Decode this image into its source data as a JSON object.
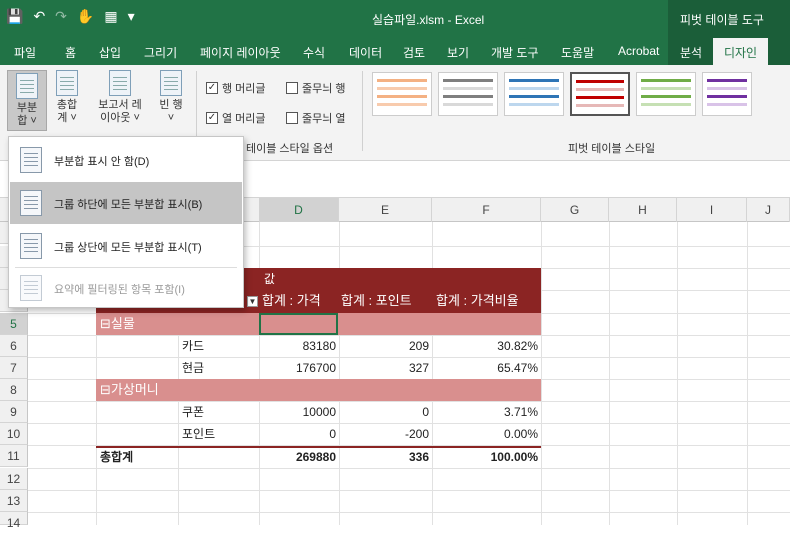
{
  "titlebar": {
    "title": "실습파일.xlsm - Excel",
    "context_tab": "피벗 테이블 도구",
    "icons": [
      "save-icon",
      "undo-icon",
      "redo-icon",
      "touch-mode-icon",
      "form-icon",
      "customize-icon"
    ]
  },
  "menu": {
    "items": [
      "파일",
      "홈",
      "삽입",
      "그리기",
      "페이지 레이아웃",
      "수식",
      "데이터",
      "검토",
      "보기",
      "개발 도구",
      "도움말",
      "Acrobat",
      "분석",
      "디자인"
    ],
    "active": "디자인"
  },
  "ribbon": {
    "subtotal": "부분합",
    "subtotal_line1": "부분",
    "subtotal_line2": "합 ˅",
    "grandtotal_line1": "총합",
    "grandtotal_line2": "계 ˅",
    "report_line1": "보고서 레",
    "report_line2": "이아웃 ˅",
    "blank_line1": "빈 행",
    "blank_line2": "˅",
    "row_headers": "행 머리글",
    "banded_rows": "줄무늬 행",
    "col_headers": "열 머리글",
    "banded_cols": "줄무늬 열",
    "style_options_label": "테이블 스타일 옵션",
    "styles_label": "피벗 테이블 스타일"
  },
  "dropdown": {
    "items": [
      {
        "label": "부분합 표시 안 함(D)"
      },
      {
        "label": "그룹 하단에 모든 부분합 표시(B)"
      },
      {
        "label": "그룹 상단에 모든 부분합 표시(T)"
      },
      {
        "label": "요약에 필터링된 항목 포함(I)"
      }
    ]
  },
  "columns": [
    "D",
    "E",
    "F",
    "G",
    "H",
    "I",
    "J"
  ],
  "rows": [
    "5",
    "6",
    "7",
    "8",
    "9",
    "10",
    "11",
    "12",
    "13",
    "14"
  ],
  "pivot": {
    "values_label": "값",
    "headers": [
      "합계 : 가격",
      "합계 : 포인트",
      "합계 : 가격비율"
    ],
    "group1": "실물",
    "group2": "가상머니",
    "items": [
      {
        "label": "카드",
        "price": "83180",
        "point": "209",
        "ratio": "30.82%"
      },
      {
        "label": "현금",
        "price": "176700",
        "point": "327",
        "ratio": "65.47%"
      },
      {
        "label": "쿠폰",
        "price": "10000",
        "point": "0",
        "ratio": "3.71%"
      },
      {
        "label": "포인트",
        "price": "0",
        "point": "-200",
        "ratio": "0.00%"
      }
    ],
    "total_label": "총합계",
    "total": {
      "price": "269880",
      "point": "336",
      "ratio": "100.00%"
    }
  },
  "colors": {
    "excel_green": "#217346",
    "pivot_dark": "#8b2423",
    "pivot_light": "#d98f8e"
  }
}
